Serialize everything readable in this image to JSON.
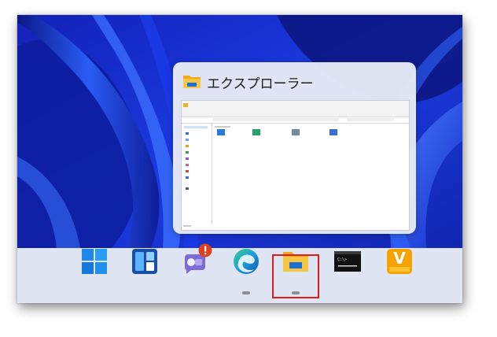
{
  "preview": {
    "title": "エクスプローラー",
    "app_icon": "file-explorer-icon"
  },
  "taskbar": {
    "items": [
      {
        "name": "start",
        "icon": "windows-start-icon"
      },
      {
        "name": "widgets",
        "icon": "widgets-icon"
      },
      {
        "name": "teams-chat",
        "icon": "teams-chat-icon",
        "badge": "!"
      },
      {
        "name": "edge",
        "icon": "edge-icon",
        "running": true
      },
      {
        "name": "file-explorer",
        "icon": "file-explorer-icon",
        "running": true,
        "highlighted": true
      },
      {
        "name": "terminal",
        "icon": "terminal-icon",
        "text": "C:\\>"
      },
      {
        "name": "viewer",
        "icon": "v-app-icon",
        "letter": "V"
      }
    ]
  },
  "colors": {
    "wallpaper": "#1a2fd8",
    "taskbar": "#dfe5f3",
    "highlight_box": "#e21b1b",
    "badge": "#e0401c",
    "folder": "#f7c03a"
  }
}
